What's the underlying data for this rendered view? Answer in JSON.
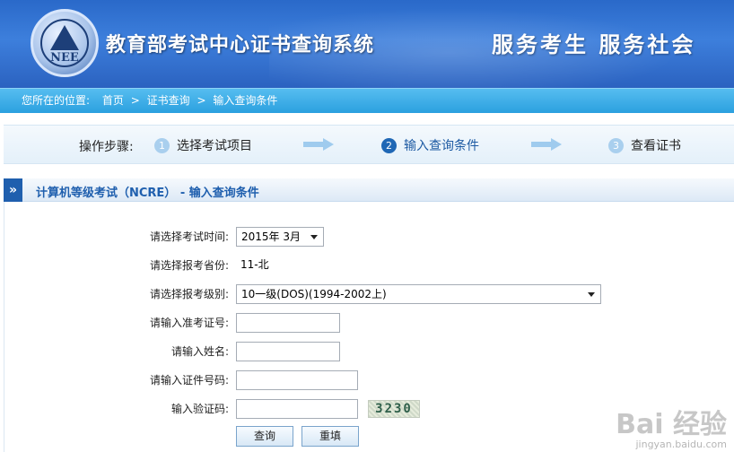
{
  "header": {
    "logo_text": "NEE",
    "title": "教育部考试中心证书查询系统",
    "slogan": "服务考生  服务社会"
  },
  "breadcrumb": {
    "prefix": "您所在的位置:",
    "items": [
      "首页",
      "证书查询",
      "输入查询条件"
    ],
    "separator": ">"
  },
  "steps": {
    "label": "操作步骤:",
    "items": [
      {
        "num": "1",
        "label": "选择考试项目"
      },
      {
        "num": "2",
        "label": "输入查询条件"
      },
      {
        "num": "3",
        "label": "查看证书"
      }
    ],
    "active_index": 1
  },
  "section": {
    "title": "计算机等级考试（NCRE） - 输入查询条件"
  },
  "form": {
    "exam_time": {
      "label": "请选择考试时间:",
      "value": "2015年 3月"
    },
    "province": {
      "label": "请选择报考省份:",
      "value": "11-北"
    },
    "level": {
      "label": "请选择报考级别:",
      "value": "10一级(DOS)(1994-2002上)"
    },
    "ticket_no": {
      "label": "请输入准考证号:",
      "value": ""
    },
    "name": {
      "label": "请输入姓名:",
      "value": ""
    },
    "id_no": {
      "label": "请输入证件号码:",
      "value": ""
    },
    "captcha": {
      "label": "输入验证码:",
      "value": "",
      "image_text": "3230"
    },
    "query_button": "查询",
    "reset_button": "重填"
  },
  "watermark": {
    "brand": "Bai 经验",
    "url": "jingyan.baidu.com"
  },
  "colors": {
    "banner": "#2a69c9",
    "breadcrumb": "#2ba0df",
    "accent": "#1f5fae"
  }
}
